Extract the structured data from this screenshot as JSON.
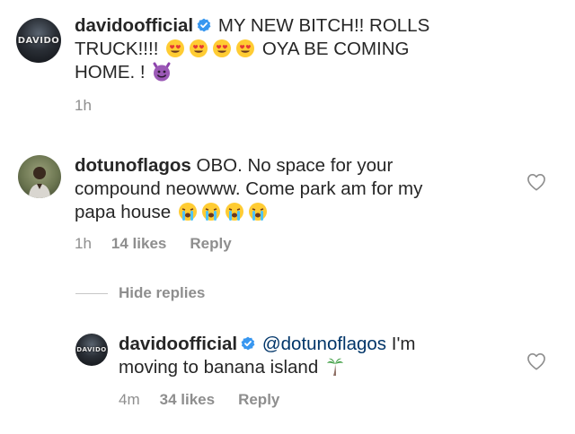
{
  "post": {
    "username": "davidoofficial",
    "avatar_logo": "DAVIDO",
    "caption_part1": "MY NEW BITCH!! ROLLS",
    "caption_part2": "TRUCK!!!!",
    "caption_part3": "OYA BE COMING",
    "caption_part4": "HOME. !",
    "time": "1h"
  },
  "comments": [
    {
      "username": "dotunoflagos",
      "text_line1": "OBO. No space for your",
      "text_line2": "compound neowww. Come park am for my",
      "text_line3": "papa house",
      "time": "1h",
      "likes": "14 likes",
      "reply": "Reply",
      "icons": {
        "like": "heart-outline-icon",
        "emoji": "loudly-crying-face-emoji"
      }
    }
  ],
  "replies_toggle": "Hide replies",
  "replies": [
    {
      "username": "davidoofficial",
      "avatar_logo": "DAVIDO",
      "mention": "@dotunoflagos",
      "text_after_mention": " I'm",
      "text_line2": "moving to banana island",
      "time": "4m",
      "likes": "34 likes",
      "reply": "Reply",
      "icons": {
        "like": "heart-outline-icon",
        "emoji": "palm-tree-emoji"
      }
    }
  ],
  "colors": {
    "text": "#262626",
    "secondary": "#8e8e8e",
    "verified": "#3897f0",
    "mention": "#003569"
  }
}
